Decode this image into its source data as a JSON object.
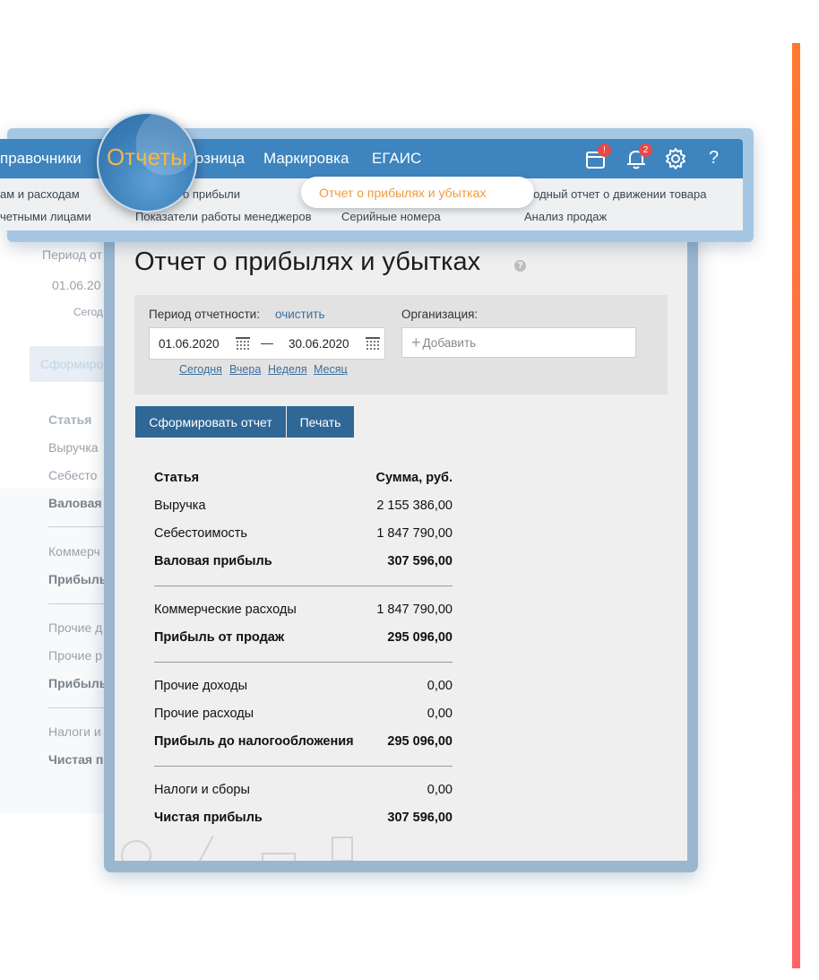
{
  "colors": {
    "accent_bar": "#ff7a2e",
    "nav_bar": "#3e84be",
    "active_menu": "#f29a3c",
    "button": "#2f6796",
    "badge": "#e84848",
    "link": "#3b6f9e"
  },
  "nav": {
    "items": [
      "правочники",
      "Отчеты",
      "озница",
      "Маркировка",
      "ЕГАИС"
    ],
    "magnified_item": "Отчеты",
    "icons": [
      "calendar-icon",
      "bell-icon",
      "gear-icon",
      "help-icon"
    ],
    "calendar_badge": "!",
    "bell_badge": "2",
    "help_label": "?"
  },
  "submenu": {
    "col1": [
      "ам и расходам",
      "четными лицами"
    ],
    "col2": [
      "о прибыли",
      "Показатели работы менеджеров"
    ],
    "col3_active": "Отчет о прибылях и убытках",
    "col3": [
      "Серийные номера"
    ],
    "col4": [
      "Сводный отчет о движении товара",
      "Анализ продаж"
    ]
  },
  "background_page": {
    "texts": [
      "Период от",
      "01.06.20",
      "Сегод",
      "Сформиро",
      "Статья",
      "Выручка",
      "Себесто",
      "Валовая",
      "Коммерч",
      "Прибыль",
      "Прочие д",
      "Прочие р",
      "Прибыль",
      "Налоги и",
      "Чистая п"
    ]
  },
  "report": {
    "title": "Отчет о прибылях и убытках",
    "help_symbol": "?",
    "period_label": "Период отчетности:",
    "clear_link": "очистить",
    "date_from": "01.06.2020",
    "date_separator": "—",
    "date_to": "30.06.2020",
    "quick_links": [
      "Сегодня",
      "Вчера",
      "Неделя",
      "Месяц"
    ],
    "org_label": "Организация:",
    "org_placeholder": "Добавить",
    "generate_button": "Сформировать отчет",
    "print_button": "Печать",
    "table_header": {
      "label": "Статья",
      "value": "Сумма, руб."
    },
    "rows": [
      {
        "label": "Выручка",
        "value": "2 155 386,00",
        "bold": false
      },
      {
        "label": "Себестоимость",
        "value": "1 847 790,00",
        "bold": false
      },
      {
        "label": "Валовая прибыль",
        "value": "307 596,00",
        "bold": true
      },
      {
        "label": "Коммерческие расходы",
        "value": "1 847 790,00",
        "bold": false
      },
      {
        "label": "Прибыль от продаж",
        "value": "295 096,00",
        "bold": true
      },
      {
        "label": "Прочие доходы",
        "value": "0,00",
        "bold": false
      },
      {
        "label": "Прочие расходы",
        "value": "0,00",
        "bold": false
      },
      {
        "label": "Прибыль до налогообложения",
        "value": "295 096,00",
        "bold": true
      },
      {
        "label": "Налоги и сборы",
        "value": "0,00",
        "bold": false
      },
      {
        "label": "Чистая прибыль",
        "value": "307 596,00",
        "bold": true
      }
    ]
  }
}
